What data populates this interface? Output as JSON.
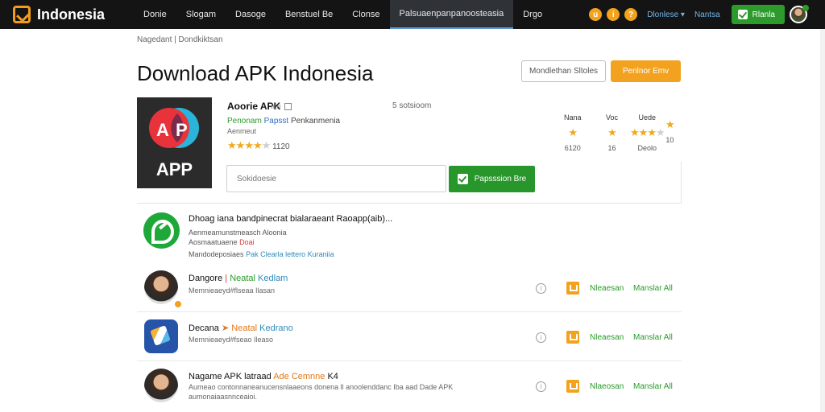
{
  "header": {
    "logo_text": "Indonesia",
    "nav": [
      "Donie",
      "Slogam",
      "Dasoge",
      "Benstuel Be",
      "Clonse",
      "Palsuaenpanpanoosteasia",
      "Drgo"
    ],
    "active_index": 5,
    "circle_icons": [
      "u",
      "i",
      "?"
    ],
    "user_link": "Dlonlese",
    "account_link": "Nantsa",
    "action_button": "Rlanla"
  },
  "breadcrumb": "Nagedant | Dondkiktsan",
  "page_title": "Download APK Indonesia",
  "buttons": {
    "outline": "Mondlethan Sltoles",
    "primary": "Penlnor Emv"
  },
  "app": {
    "icon_text": "APP",
    "name": "Aoorie APK",
    "meta": "Inn",
    "rating_count": "5 sotsioom",
    "developer_green": "Penonam",
    "developer_blue": "Papsst",
    "developer_dark": "Penkanmenia",
    "category": "Aenmeut",
    "stars": 4,
    "rating_text": "1120",
    "stats": [
      {
        "label": "Nana",
        "value": "6120",
        "stars": 2
      },
      {
        "label": "Voc",
        "value": "16",
        "stars": 1
      },
      {
        "label": "Uede",
        "value": "Deolo",
        "stars": 3
      },
      {
        "label": "",
        "value": "10",
        "stars": 1
      }
    ],
    "search_placeholder": "Sokidoesie",
    "search_button": "Papsssion Bre"
  },
  "featured": {
    "title": "Dhoag iana bandpinecrat bialaraeant Raoapp(aib)...",
    "line1": "Aenmeamunstmeasch Aloonia",
    "line2_text": "Aosmaatuaene",
    "line2_red": "Doai",
    "line3_text": "Mandodeposiaes",
    "line3_t1": "Pak Clearla lettero",
    "line3_t2": "Kuraniia"
  },
  "list": [
    {
      "title": "Dangore",
      "tag1": "Neatal",
      "tag2": "Kedlam",
      "subtitle": "Memnieaeyd#flseaa Ilasan",
      "link1": "Nleaesan",
      "link2": "Manslar All",
      "icon": "face"
    },
    {
      "title": "Decana",
      "tag1": "Neatal",
      "tag2": "Kedrano",
      "subtitle": "Memnieaeyd#fseao Ileaso",
      "link1": "Nleaesan",
      "link2": "Manslar All",
      "icon": "cube"
    },
    {
      "title": "Nagame APK latraad",
      "tag1": "Ade",
      "tag2": "Cemnne",
      "tag3": "K4",
      "subtitle": "Aumeao contonnaneanucensnlaaeons donena ll anoolenddanc Iba aad Dade APK",
      "subtitle2": "aumonaiaasnnceaioi.",
      "link1": "Nlaeosan",
      "link2": "Manslar All",
      "icon": "face"
    }
  ],
  "colors": {
    "nav_bg": "#141414",
    "accent_orange": "#f3a21f",
    "accent_green": "#27962b",
    "link_blue": "#2e8ab8"
  }
}
